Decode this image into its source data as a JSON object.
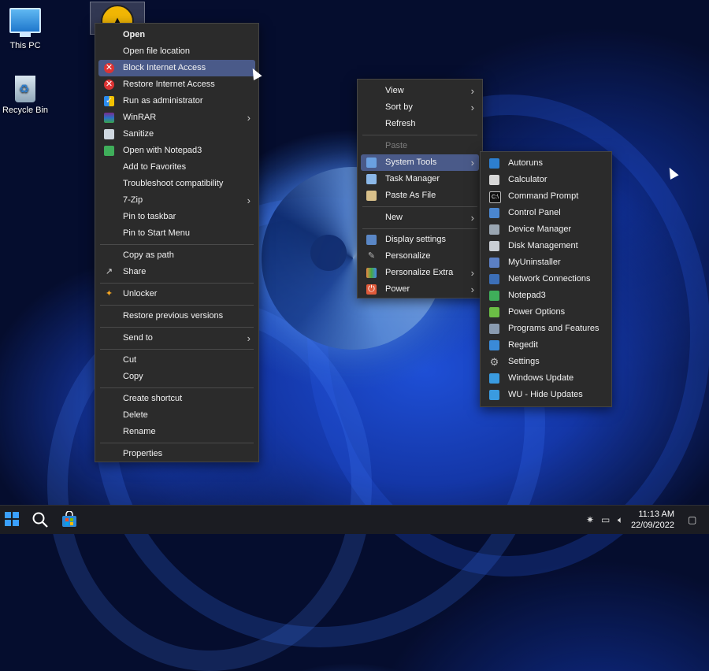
{
  "desktop": {
    "icons": [
      {
        "label": "This PC"
      },
      {
        "label": "Recycle Bin"
      }
    ]
  },
  "context_menu": {
    "items": [
      {
        "label": "Open",
        "bold": true
      },
      {
        "label": "Open file location"
      },
      {
        "label": "Block Internet Access",
        "icon": "block-icon",
        "highlighted": true
      },
      {
        "label": "Restore Internet Access",
        "icon": "restore-icon"
      },
      {
        "label": "Run as administrator",
        "icon": "shield-icon"
      },
      {
        "label": "WinRAR",
        "icon": "winrar-icon",
        "submenu": true
      },
      {
        "label": "Sanitize",
        "icon": "sanitize-icon"
      },
      {
        "label": "Open with Notepad3",
        "icon": "notepad-icon"
      },
      {
        "label": "Add to Favorites"
      },
      {
        "label": "Troubleshoot compatibility"
      },
      {
        "label": "7-Zip",
        "submenu": true
      },
      {
        "label": "Pin to taskbar"
      },
      {
        "label": "Pin to Start Menu"
      },
      {
        "label": "Copy as path"
      },
      {
        "label": "Share",
        "icon": "share-icon"
      },
      {
        "label": "Unlocker",
        "icon": "unlocker-icon"
      },
      {
        "label": "Restore previous versions"
      },
      {
        "label": "Send to",
        "submenu": true
      },
      {
        "label": "Cut"
      },
      {
        "label": "Copy"
      },
      {
        "label": "Create shortcut"
      },
      {
        "label": "Delete"
      },
      {
        "label": "Rename"
      },
      {
        "label": "Properties"
      }
    ]
  },
  "desktop_menu": {
    "items": [
      {
        "label": "View",
        "submenu": true
      },
      {
        "label": "Sort by",
        "submenu": true
      },
      {
        "label": "Refresh"
      },
      {
        "label": "Paste",
        "disabled": true
      },
      {
        "label": "System Tools",
        "icon": "system-tools-icon",
        "submenu": true,
        "highlighted": true
      },
      {
        "label": "Task Manager",
        "icon": "task-manager-icon"
      },
      {
        "label": "Paste As File",
        "icon": "paste-file-icon"
      },
      {
        "label": "New",
        "submenu": true
      },
      {
        "label": "Display settings",
        "icon": "display-icon"
      },
      {
        "label": "Personalize",
        "icon": "brush-icon"
      },
      {
        "label": "Personalize Extra",
        "icon": "personalize-extra-icon",
        "submenu": true
      },
      {
        "label": "Power",
        "icon": "power-icon",
        "submenu": true
      }
    ]
  },
  "system_tools_menu": {
    "items": [
      {
        "label": "Autoruns",
        "icon": "autoruns-icon"
      },
      {
        "label": "Calculator",
        "icon": "calculator-icon"
      },
      {
        "label": "Command Prompt",
        "icon": "cmd-icon"
      },
      {
        "label": "Control Panel",
        "icon": "control-panel-icon"
      },
      {
        "label": "Device Manager",
        "icon": "device-manager-icon"
      },
      {
        "label": "Disk Management",
        "icon": "disk-icon"
      },
      {
        "label": "MyUninstaller",
        "icon": "uninstaller-icon"
      },
      {
        "label": "Network Connections",
        "icon": "network-icon"
      },
      {
        "label": "Notepad3",
        "icon": "notepad-icon"
      },
      {
        "label": "Power Options",
        "icon": "power-options-icon"
      },
      {
        "label": "Programs and Features",
        "icon": "programs-icon"
      },
      {
        "label": "Regedit",
        "icon": "regedit-icon"
      },
      {
        "label": "Settings",
        "icon": "gear-icon"
      },
      {
        "label": "Windows Update",
        "icon": "update-icon"
      },
      {
        "label": "WU - Hide Updates",
        "icon": "update-hide-icon"
      }
    ]
  },
  "taskbar": {
    "time": "11:13 AM",
    "date": "22/09/2022"
  }
}
